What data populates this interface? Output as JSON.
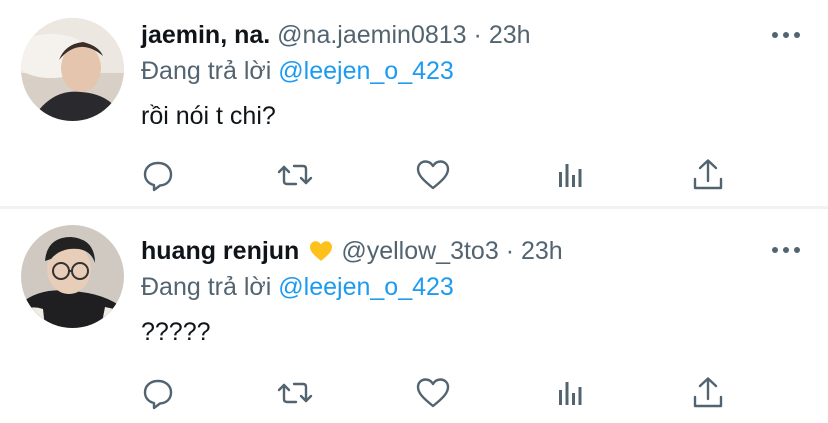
{
  "tweets": [
    {
      "name": "jaemin, na.",
      "handle": "@na.jaemin0813",
      "dot": "·",
      "time": "23h",
      "reply_prefix": "Đang trả lời",
      "reply_to": "@leejen_o_423",
      "text": "rồi nói t chi?",
      "has_emoji": false
    },
    {
      "name": "huang renjun",
      "handle": "@yellow_3to3",
      "dot": "·",
      "time": "23h",
      "reply_prefix": "Đang trả lời",
      "reply_to": "@leejen_o_423",
      "text": "?????",
      "has_emoji": true,
      "emoji_name": "yellow-heart-icon"
    }
  ],
  "icons": [
    "reply-icon",
    "retweet-icon",
    "like-icon",
    "analytics-icon",
    "share-icon",
    "more-options-icon"
  ],
  "colors": {
    "text_primary": "#0f1419",
    "text_secondary": "#536471",
    "accent": "#1d9bf0",
    "divider": "#eff3f4",
    "emoji_yellow": "#fcc21b"
  }
}
